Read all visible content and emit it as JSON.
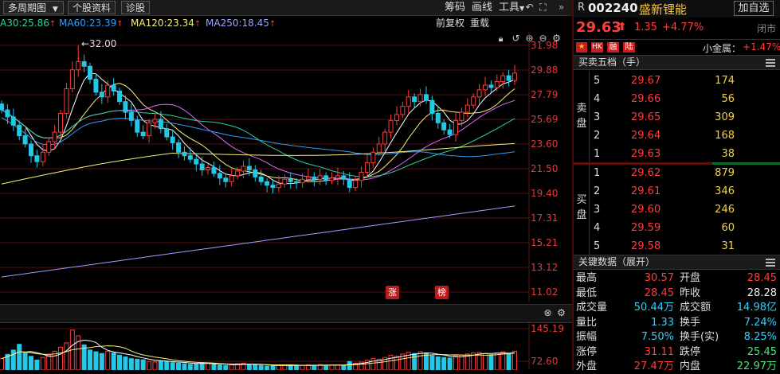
{
  "toolbar": {
    "period": "多周期图",
    "stock_info": "个股资料",
    "diagnose": "诊股",
    "chip": "筹码",
    "draw": "画线",
    "tools": "工具",
    "more": "»",
    "restore_icon": "undo-icon",
    "fullscreen_icon": "fullscreen-icon"
  },
  "ma": {
    "ma30": "A30:25.86",
    "ma60": "MA60:23.39",
    "ma120": "MA120:23.34",
    "ma250": "MA250:18.45",
    "arrow": "↑",
    "fq_before": "前复权",
    "redraw": "重载",
    "colors": {
      "ma30": "#2fd0a0",
      "ma60": "#2f9df7",
      "ma120": "#f5f07a",
      "ma250": "#9aa3ff"
    }
  },
  "chart": {
    "high_marker": "←32.00",
    "yticks": [
      "31.98",
      "29.88",
      "27.79",
      "25.69",
      "23.60",
      "21.50",
      "19.40",
      "17.31",
      "15.21",
      "13.12",
      "11.02"
    ],
    "tag_zhang": "涨",
    "tag_bang": "榜"
  },
  "volume": {
    "yticks": [
      "145.19",
      "72.60"
    ]
  },
  "quote": {
    "market": "R",
    "code": "002240",
    "name": "盛新锂能",
    "add_self": "加自选",
    "price": "29.63",
    "change": "1.35",
    "change_pct": "+4.77%",
    "status": "闭市",
    "badges": [
      "HK",
      "融",
      "陆"
    ],
    "small_cap_label": "小金属：",
    "small_cap_value": "+1.47%"
  },
  "orderbook": {
    "title": "买卖五档（手）",
    "sell_label": "卖盘",
    "buy_label": "买盘",
    "sell": [
      {
        "level": "5",
        "price": "29.67",
        "vol": "174"
      },
      {
        "level": "4",
        "price": "29.66",
        "vol": "56"
      },
      {
        "level": "3",
        "price": "29.65",
        "vol": "309"
      },
      {
        "level": "2",
        "price": "29.64",
        "vol": "168"
      },
      {
        "level": "1",
        "price": "29.63",
        "vol": "38"
      }
    ],
    "buy": [
      {
        "level": "1",
        "price": "29.62",
        "vol": "879"
      },
      {
        "level": "2",
        "price": "29.61",
        "vol": "346"
      },
      {
        "level": "3",
        "price": "29.60",
        "vol": "246"
      },
      {
        "level": "4",
        "price": "29.59",
        "vol": "60"
      },
      {
        "level": "5",
        "price": "29.58",
        "vol": "31"
      }
    ]
  },
  "keydata": {
    "title": "关键数据（展开）",
    "rows": [
      {
        "l1": "最高",
        "v1": "30.57",
        "l2": "开盘",
        "v2": "28.45"
      },
      {
        "l1": "最低",
        "v1": "28.45",
        "l2": "昨收",
        "v2": "28.28"
      },
      {
        "l1": "成交量",
        "v1": "50.44万",
        "l2": "成交额",
        "v2": "14.98亿"
      },
      {
        "l1": "量比",
        "v1": "1.33",
        "l2": "换手",
        "v2": "7.24%"
      },
      {
        "l1": "振幅",
        "v1": "7.50%",
        "l2": "换手(实)",
        "v2": "8.25%"
      },
      {
        "l1": "涨停",
        "v1": "31.11",
        "l2": "跌停",
        "v2": "25.45"
      },
      {
        "l1": "外盘",
        "v1": "27.47万",
        "l2": "内盘",
        "v2": "22.97万"
      }
    ]
  }
}
